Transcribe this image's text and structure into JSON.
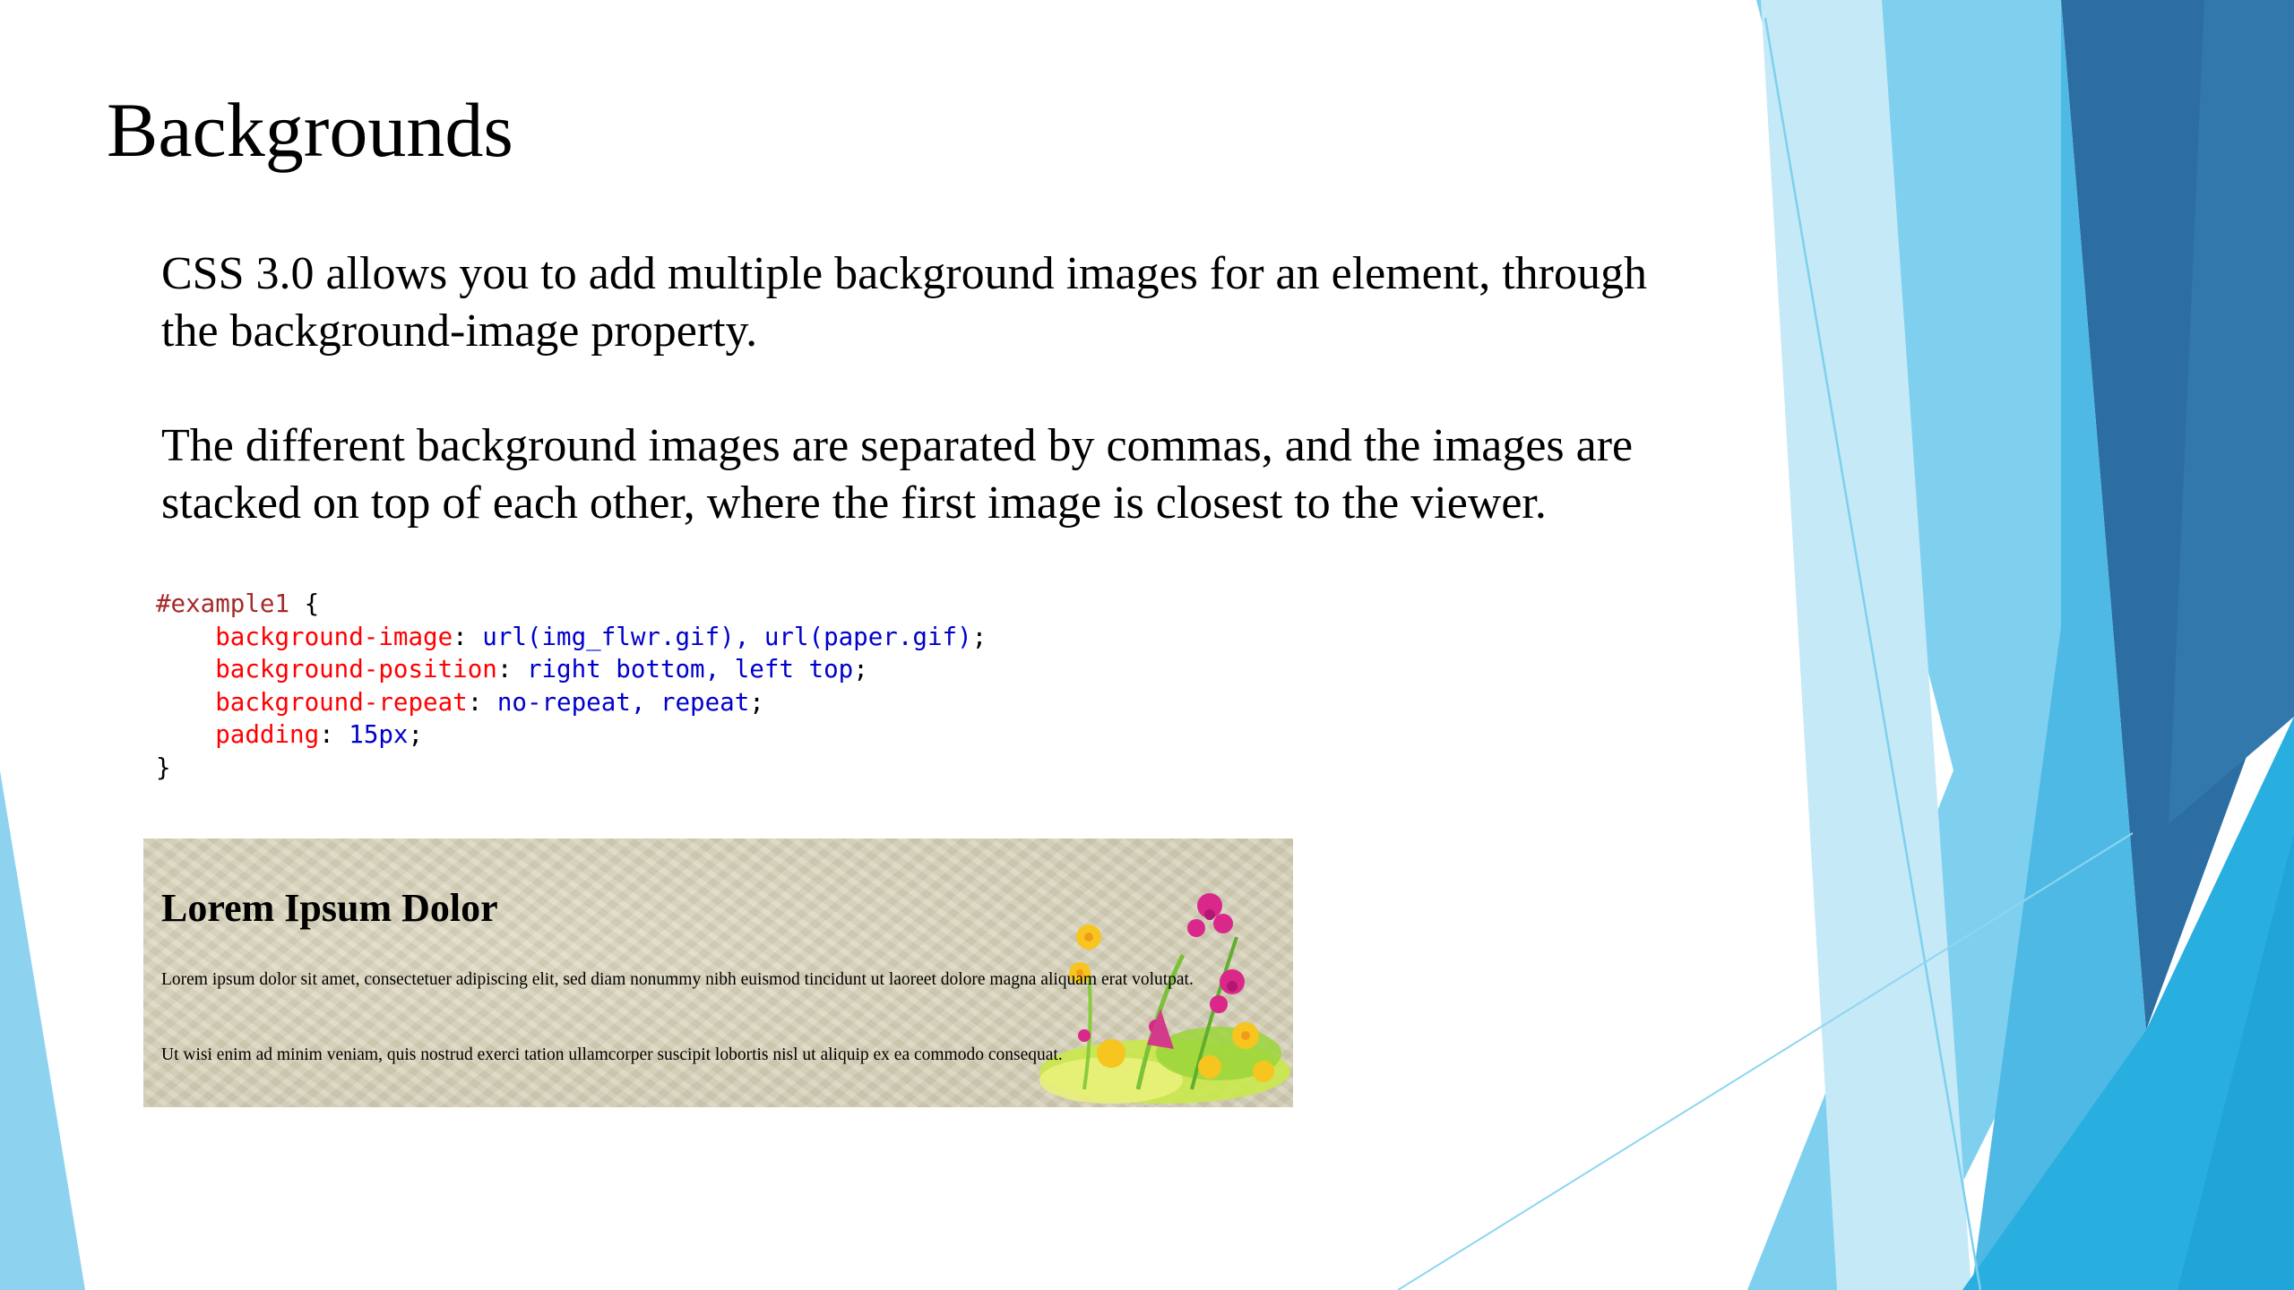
{
  "slide": {
    "title": "Backgrounds",
    "paragraph_1": "CSS 3.0 allows you to add multiple background images for an element, through the background-image property.",
    "paragraph_2": "The different background images are separated by commas, and the images are stacked on top of each other, where the first image is closest to the viewer."
  },
  "code": {
    "selector": "#example1",
    "open_brace": " {",
    "close_brace": "}",
    "lines": [
      {
        "property": "background-image",
        "value": "url(img_flwr.gif), url(paper.gif)"
      },
      {
        "property": "background-position",
        "value": "right bottom, left top"
      },
      {
        "property": "background-repeat",
        "value": "no-repeat, repeat"
      },
      {
        "property": "padding",
        "value": "15px"
      }
    ]
  },
  "demo": {
    "heading": "Lorem Ipsum Dolor",
    "paragraph_1": "Lorem ipsum dolor sit amet, consectetuer adipiscing elit, sed diam nonummy nibh euismod tincidunt ut laoreet dolore magna aliquam erat volutpat.",
    "paragraph_2": "Ut wisi enim ad minim veniam, quis nostrud exerci tation ullamcorper suscipit lobortis nisl ut aliquip ex ea commodo consequat."
  },
  "colors": {
    "code_selector": "#a52a2a",
    "code_property": "#ff0000",
    "code_value": "#0000cd",
    "theme_light_blue": "#7dd0ef",
    "theme_blue": "#29aee0",
    "theme_dark_blue": "#2b6fa3"
  }
}
